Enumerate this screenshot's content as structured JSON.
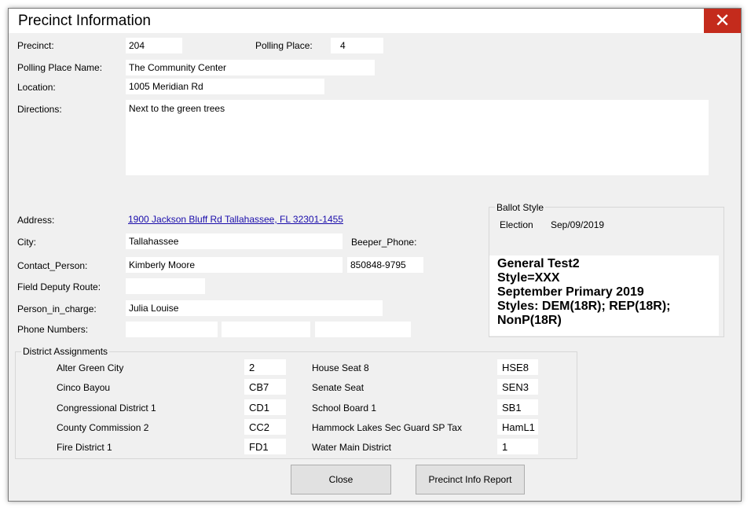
{
  "window": {
    "title": "Precinct Information",
    "close_glyph": "✕"
  },
  "labels": {
    "precinct": "Precinct:",
    "polling_place": "Polling Place:",
    "polling_place_name": "Polling Place Name:",
    "location": "Location:",
    "directions": "Directions:",
    "address": "Address:",
    "city": "City:",
    "beeper_phone": "Beeper_Phone:",
    "contact_person": "Contact_Person:",
    "field_deputy_route": "Field Deputy Route:",
    "person_in_charge": "Person_in_charge:",
    "phone_numbers": "Phone Numbers:"
  },
  "values": {
    "precinct": "204",
    "polling_place": "4",
    "polling_place_name": "The Community Center",
    "location": "1005 Meridian Rd",
    "directions": "Next to the green trees",
    "address": "1900 Jackson Bluff Rd Tallahassee, FL 32301-1455",
    "city": "Tallahassee",
    "beeper_phone": "850848-9795",
    "contact_person": "Kimberly Moore",
    "field_deputy_route": "",
    "person_in_charge": "Julia Louise",
    "phone_1": "",
    "phone_2": "",
    "phone_3": ""
  },
  "ballot_style": {
    "title": "Ballot Style",
    "election_label": "Election",
    "election_date": "Sep/09/2019",
    "lines": [
      "General Test2",
      "Style=XXX",
      "September Primary 2019",
      "Styles: DEM(18R);  REP(18R);",
      "NonP(18R)"
    ]
  },
  "district_assignments": {
    "title": "District Assignments",
    "left": [
      {
        "label": "Alter Green City",
        "value": "2"
      },
      {
        "label": "Cinco Bayou",
        "value": "CB7"
      },
      {
        "label": "Congressional District 1",
        "value": "CD1"
      },
      {
        "label": "County Commission 2",
        "value": "CC2"
      },
      {
        "label": "Fire District 1",
        "value": "FD1"
      }
    ],
    "right": [
      {
        "label": "House Seat 8",
        "value": "HSE8"
      },
      {
        "label": "Senate Seat",
        "value": "SEN3"
      },
      {
        "label": "School Board 1",
        "value": "SB1"
      },
      {
        "label": "Hammock Lakes Sec Guard SP Tax",
        "value": "HamL1"
      },
      {
        "label": "Water Main District",
        "value": "1"
      }
    ]
  },
  "buttons": {
    "close": "Close",
    "report": "Precinct Info Report"
  }
}
